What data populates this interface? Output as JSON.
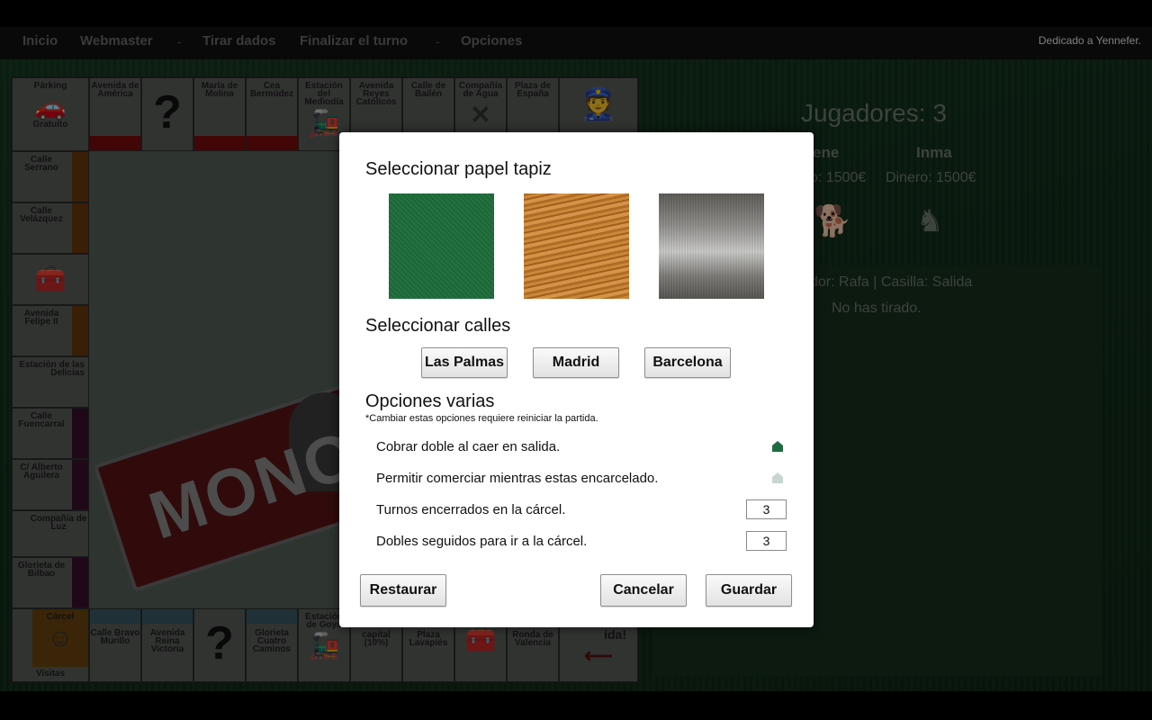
{
  "nav": {
    "items": [
      {
        "label": "Inicio"
      },
      {
        "label": "Webmaster"
      },
      {
        "label": "Tirar dados"
      },
      {
        "label": "Finalizar el turno"
      },
      {
        "label": "Opciones"
      }
    ],
    "separator": "-",
    "dedication": "Dedicado a Yennefer."
  },
  "board": {
    "top_row": [
      "Párking",
      "Gratuito",
      "Avenida de América",
      "?",
      "María de Molina",
      "Cea Bermúdez",
      "Estación del Mediodía",
      "Avenida Reyes Católicos",
      "Calle de Bailén",
      "Compañía de Agua",
      "Plaza de España"
    ],
    "left_col": [
      "Calle Serrano",
      "Calle Velázquez",
      "Avenida Felipe II",
      "Estación de las Delicias",
      "Calle Fuencarral",
      "C/ Alberto Aguilera",
      "Compañía de Luz",
      "Glorieta de Bilbao"
    ],
    "bottom_row": [
      "Cárcel",
      "Visitas",
      "Calle Bravo Murillo",
      "Avenida Reina Victoria",
      "?",
      "Glorieta Cuatro Caminos",
      "Estación de Goya",
      "capital (10%)",
      "Plaza Lavapiés",
      "Ronda de Valencia",
      "ida!"
    ],
    "logo": "MONO"
  },
  "players": {
    "title": "Jugadores: 3",
    "list": [
      {
        "name": "ene",
        "money": "o: 1500€"
      },
      {
        "name": "Inma",
        "money": "Dinero: 1500€"
      }
    ]
  },
  "log": {
    "line1": "dor: Rafa | Casilla: Salida",
    "line2": "No has tirado."
  },
  "modal": {
    "wallpaper_title": "Seleccionar papel tapiz",
    "streets_title": "Seleccionar calles",
    "street_options": [
      {
        "label": "Las Palmas"
      },
      {
        "label": "Madrid"
      },
      {
        "label": "Barcelona"
      }
    ],
    "misc_title": "Opciones varias",
    "note": "*Cambiar estas opciones requiere reiniciar la partida.",
    "options": [
      {
        "label": "Cobrar doble al caer en salida."
      },
      {
        "label": "Permitir comerciar mientras estas encarcelado."
      },
      {
        "label": "Turnos encerrados en la cárcel.",
        "value": "3"
      },
      {
        "label": "Dobles seguidos para ir a la cárcel.",
        "value": "3"
      }
    ],
    "buttons": {
      "restore": "Restaurar",
      "cancel": "Cancelar",
      "save": "Guardar"
    }
  },
  "colors": {
    "wallpaper_green": "#1d6b3a",
    "toggle_on": "#1f6b41",
    "toggle_off": "#c9d6cf"
  }
}
